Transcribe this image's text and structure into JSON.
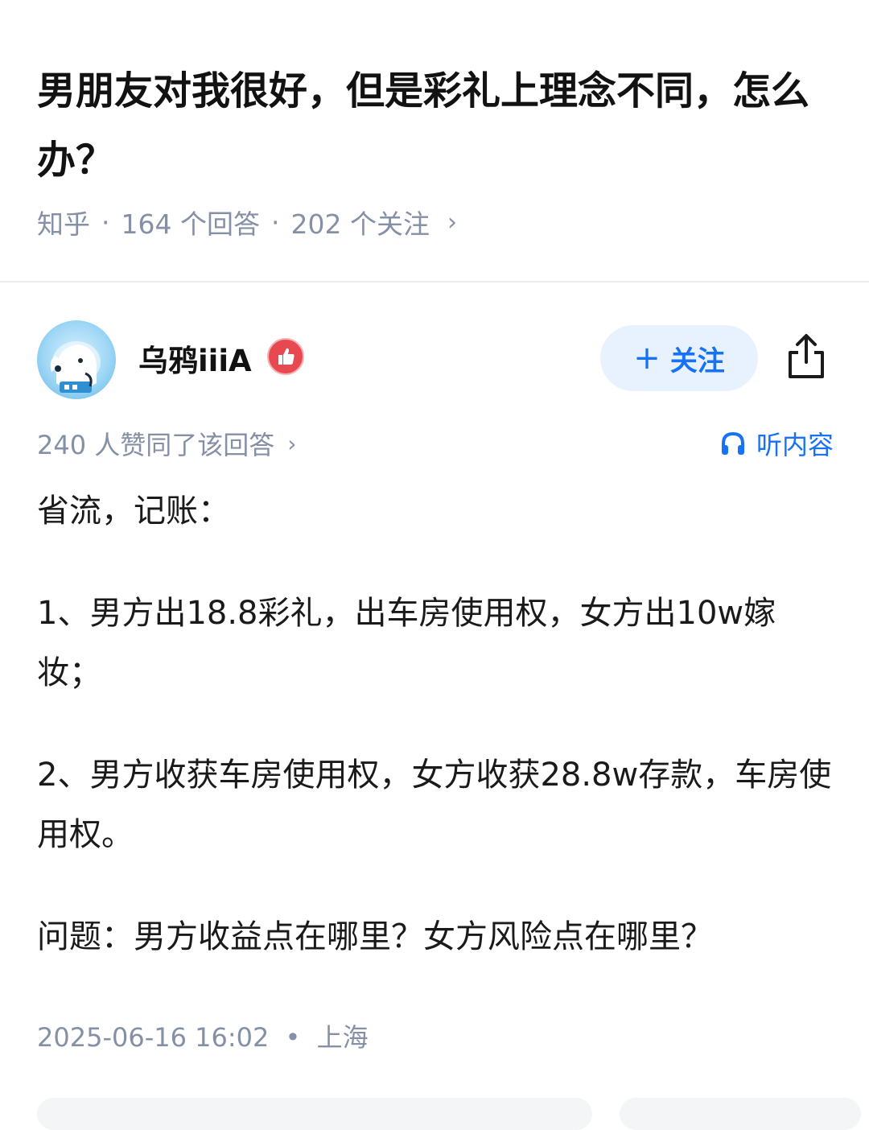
{
  "question": {
    "title": "男朋友对我很好，但是彩礼上理念不同，怎么办？",
    "source": "知乎",
    "answers_count": "164 个回答",
    "followers_count": "202 个关注"
  },
  "author": {
    "name": "乌鸦iiiA",
    "follow_label": "关注",
    "follow_plus": "+"
  },
  "answer": {
    "votes_text": "240 人赞同了该回答",
    "listen_label": "听内容",
    "paragraphs": [
      "省流，记账：",
      "1、男方出18.8彩礼，出车房使用权，女方出10w嫁妆；",
      "2、男方收获车房使用权，女方收获28.8w存款，车房使用权。",
      "问题：男方收益点在哪里？女方风险点在哪里？"
    ],
    "date": "2025-06-16 16:02",
    "location": "上海"
  },
  "glyphs": {
    "separator": "·",
    "chevron": "›",
    "location_dot": "•"
  },
  "colors": {
    "accent": "#1772f6",
    "muted": "#8590a6",
    "badge": "#e8484f"
  },
  "icons": [
    "avatar-dog-icon",
    "thumbs-up-badge-icon",
    "share-icon",
    "headphones-icon",
    "chevron-right-icon"
  ]
}
